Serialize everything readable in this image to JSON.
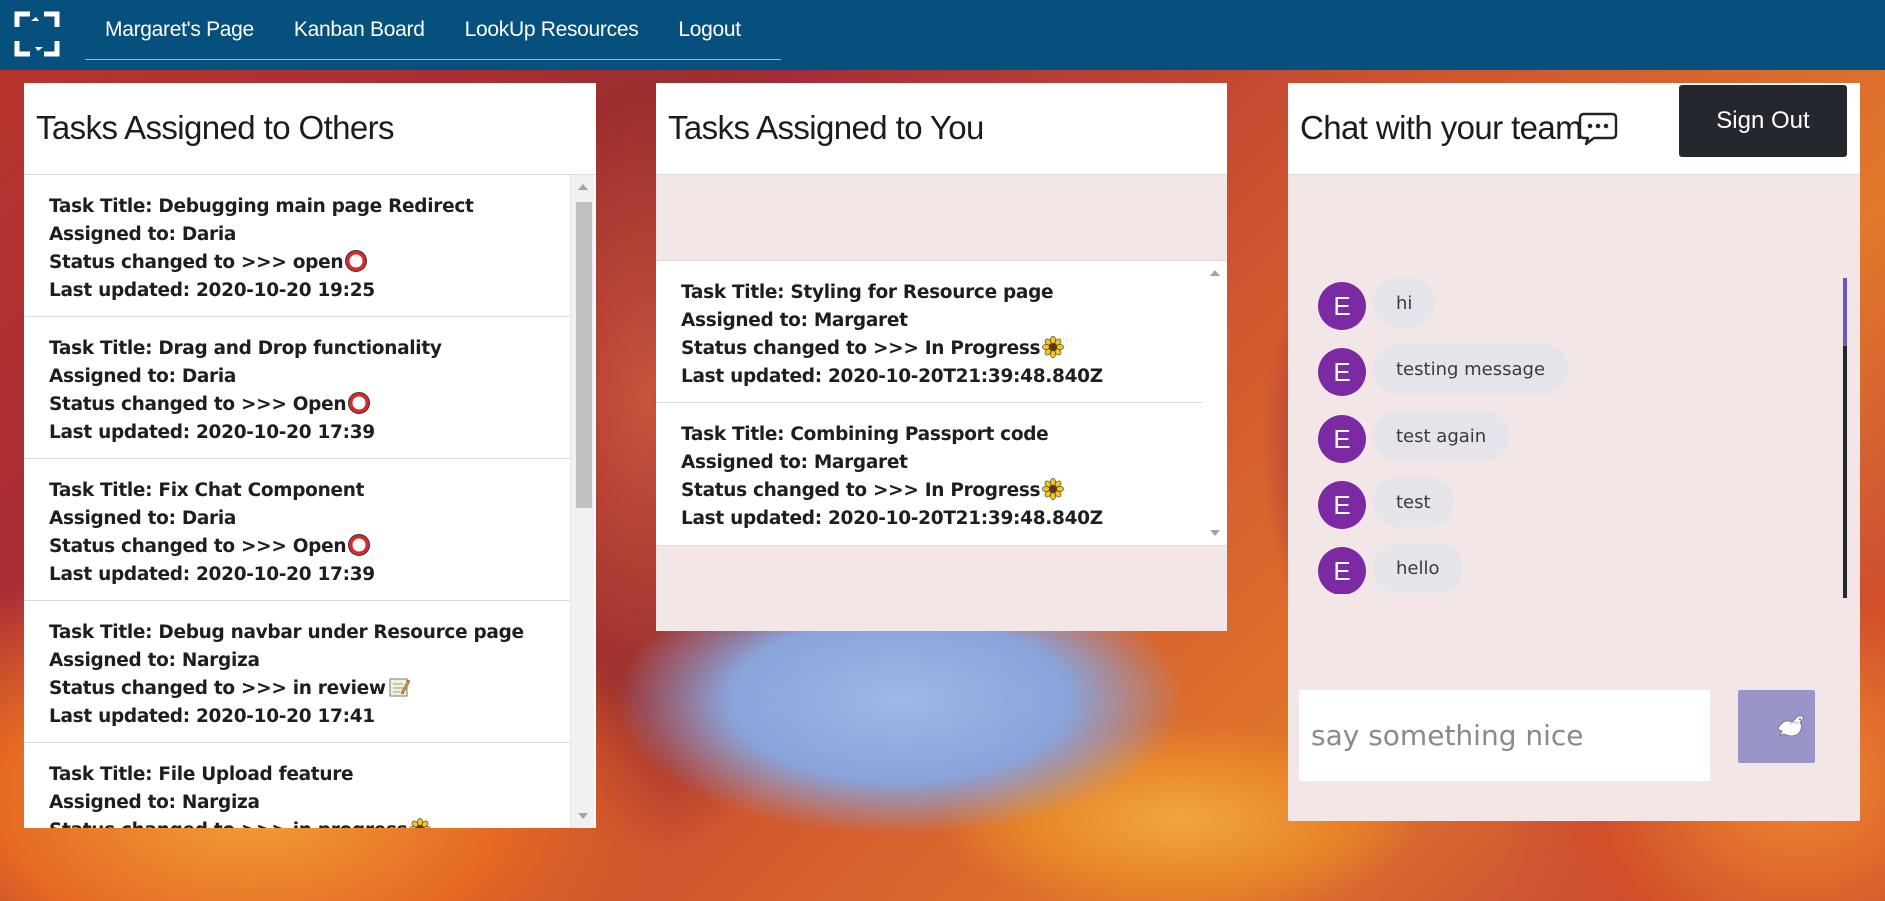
{
  "navbar": {
    "links": [
      "Margaret's Page",
      "Kanban Board",
      "LookUp Resources",
      "Logout"
    ]
  },
  "others": {
    "title": "Tasks Assigned to Others",
    "tasks": [
      {
        "title": "Task Title: Debugging main page Redirect",
        "assigned": "Assigned to: Daria",
        "status": "Status changed to >>> open",
        "status_icon": "red-circle-icon",
        "updated": "Last updated: 2020-10-20 19:25"
      },
      {
        "title": "Task Title: Drag and Drop functionality",
        "assigned": "Assigned to: Daria",
        "status": "Status changed to >>> Open",
        "status_icon": "red-circle-icon",
        "updated": "Last updated: 2020-10-20 17:39"
      },
      {
        "title": "Task Title: Fix Chat Component",
        "assigned": "Assigned to: Daria",
        "status": "Status changed to >>> Open",
        "status_icon": "red-circle-icon",
        "updated": "Last updated: 2020-10-20 17:39"
      },
      {
        "title": "Task Title: Debug navbar under Resource page",
        "assigned": "Assigned to: Nargiza",
        "status": "Status changed to >>> in review",
        "status_icon": "memo-icon",
        "updated": "Last updated: 2020-10-20 17:41"
      },
      {
        "title": "Task Title: File Upload feature",
        "assigned": "Assigned to: Nargiza",
        "status": "Status changed to >>> in progress",
        "status_icon": "sunflower-icon",
        "updated": ""
      }
    ]
  },
  "you": {
    "title": "Tasks Assigned to You",
    "tasks": [
      {
        "title": "Task Title: Styling for Resource page",
        "assigned": "Assigned to: Margaret",
        "status": "Status changed to >>> In Progress",
        "status_icon": "sunflower-icon",
        "updated": "Last updated: 2020-10-20T21:39:48.840Z"
      },
      {
        "title": "Task Title: Combining Passport code",
        "assigned": "Assigned to: Margaret",
        "status": "Status changed to >>> In Progress",
        "status_icon": "sunflower-icon",
        "updated": "Last updated: 2020-10-20T21:39:48.840Z"
      }
    ]
  },
  "chat": {
    "title": "Chat with your team",
    "signout_label": "Sign Out",
    "messages": [
      {
        "avatar": "E",
        "text": "hi"
      },
      {
        "avatar": "E",
        "text": "testing message"
      },
      {
        "avatar": "E",
        "text": "test again"
      },
      {
        "avatar": "E",
        "text": "test"
      },
      {
        "avatar": "E",
        "text": "hello"
      }
    ],
    "input_placeholder": "say something nice",
    "send_icon": "dove-icon"
  },
  "colors": {
    "navbar": "#06507d",
    "avatar": "#7b2aa3",
    "send_button": "#9a95c9",
    "signout_button": "#24282e",
    "panel_tint": "#f3e6e7"
  }
}
